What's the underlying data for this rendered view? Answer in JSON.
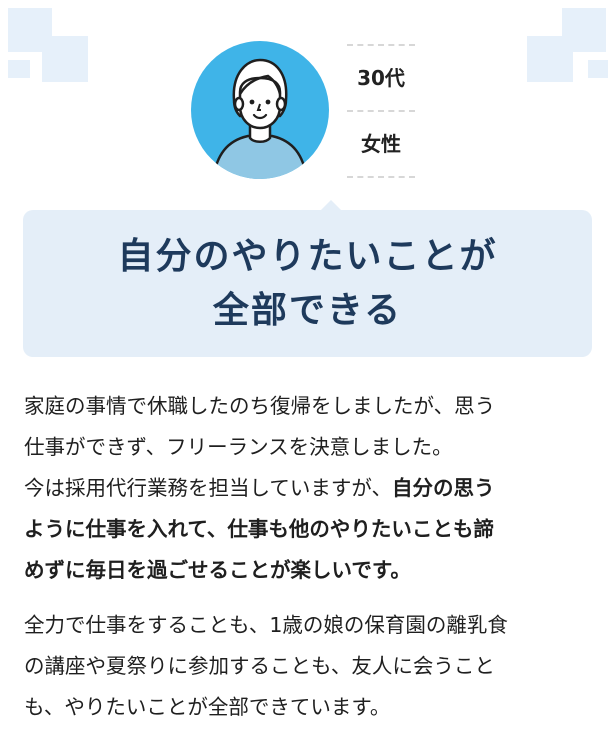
{
  "profile": {
    "age": "30代",
    "gender": "女性"
  },
  "headline": {
    "line1": "自分のやりたいことが",
    "line2": "全部できる"
  },
  "story": {
    "p1_line1": "家庭の事情で休職したのち復帰をしましたが、思う",
    "p1_line2": "仕事ができず、フリーランスを決意しました。",
    "p1_line3_plain": "今は採用代行業務を担当していますが、",
    "p1_line3_bold": "自分の思う",
    "p1_line4_bold": "ように仕事を入れて、仕事も他のやりたいことも諦",
    "p1_line5_bold": "めずに毎日を過ごせることが楽しいです。",
    "p2_line1": "全力で仕事をすることも、1歳の娘の保育園の離乳食",
    "p2_line2": "の講座や夏祭りに参加することも、友人に会うこと",
    "p2_line3": "も、やりたいことが全部できています。"
  },
  "colors": {
    "accent": "#1e3a5c",
    "bubble": "#e4eef8",
    "avatar_bg": "#3fb4e8",
    "decor": "#e6f0fa"
  },
  "icons": {
    "avatar": "woman-avatar-icon"
  }
}
